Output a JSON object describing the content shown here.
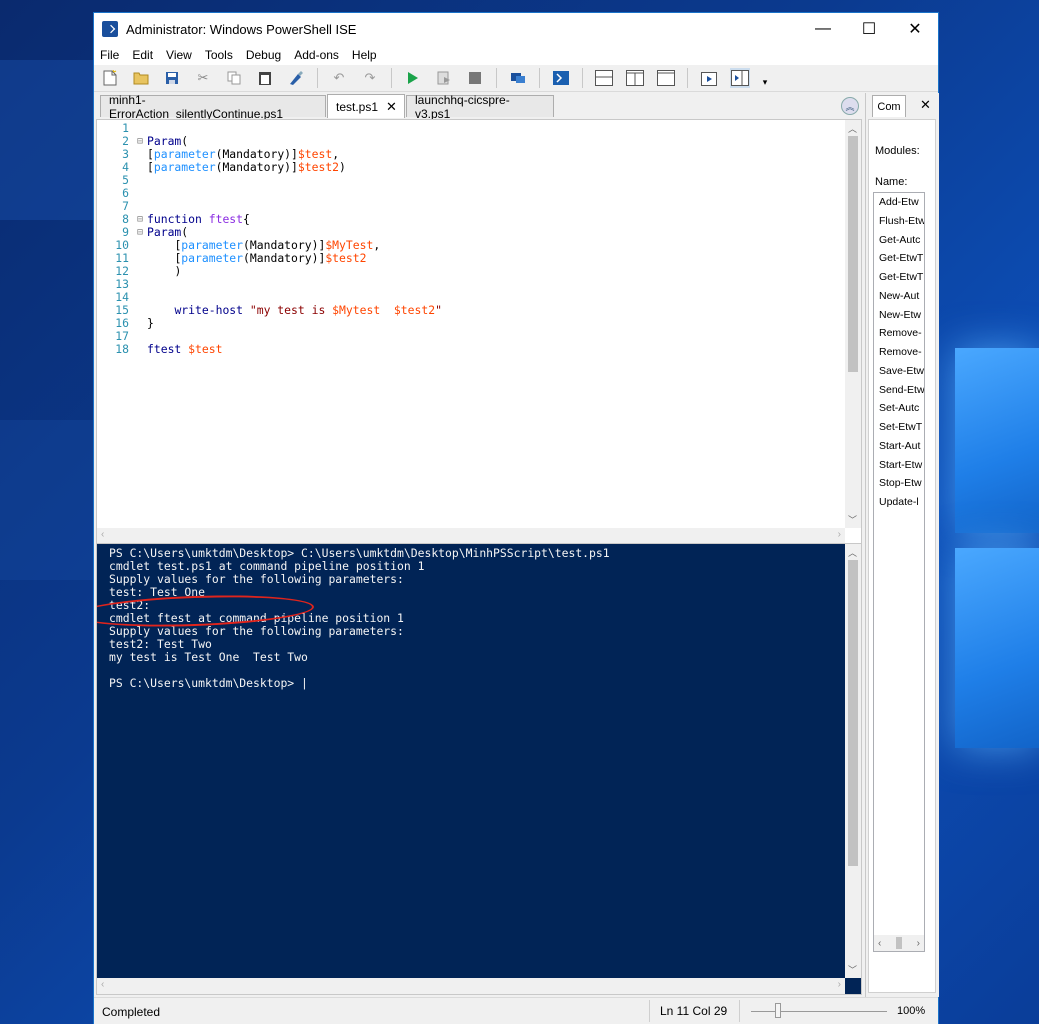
{
  "window": {
    "title": "Administrator: Windows PowerShell ISE",
    "controls": {
      "minimize": "—",
      "maximize": "☐",
      "close": "✕"
    }
  },
  "menu": [
    "File",
    "Edit",
    "View",
    "Tools",
    "Debug",
    "Add-ons",
    "Help"
  ],
  "toolbar": [
    "new-icon",
    "open-icon",
    "save-icon",
    "cut-icon",
    "copy-icon",
    "paste-icon",
    "clear-icon",
    "undo-icon",
    "redo-icon",
    "run-icon",
    "run-selection-icon",
    "stop-icon",
    "remote-icon",
    "powershell-icon",
    "layout-top-icon",
    "layout-right-icon",
    "layout-max-icon",
    "show-script-icon",
    "show-commands-icon"
  ],
  "tabs": [
    {
      "label": "minh1-ErrorAction_silentlyContinue.ps1",
      "active": false
    },
    {
      "label": "test.ps1",
      "active": true
    },
    {
      "label": "launchhq-cicspre-v3.ps1",
      "active": false
    }
  ],
  "editor": {
    "lines": [
      {
        "n": "1",
        "fold": "",
        "html": ""
      },
      {
        "n": "2",
        "fold": "⊟",
        "html": "<span class='kw'>Param</span><span class='tx'>(</span>"
      },
      {
        "n": "3",
        "fold": "",
        "html": "<span class='tx'>[</span><span class='at'>parameter</span><span class='tx'>(Mandatory)]</span><span class='vr'>$test</span><span class='tx'>,</span>"
      },
      {
        "n": "4",
        "fold": "",
        "html": "<span class='tx'>[</span><span class='at'>parameter</span><span class='tx'>(Mandatory)]</span><span class='vr'>$test2</span><span class='tx'>)</span>"
      },
      {
        "n": "5",
        "fold": "",
        "html": ""
      },
      {
        "n": "6",
        "fold": "",
        "html": ""
      },
      {
        "n": "7",
        "fold": "",
        "html": ""
      },
      {
        "n": "8",
        "fold": "⊟",
        "html": "<span class='kw'>function</span> <span class='fn'>ftest</span><span class='tx'>{</span>"
      },
      {
        "n": "9",
        "fold": "⊟",
        "html": "<span class='kw'>Param</span><span class='tx'>(</span>"
      },
      {
        "n": "10",
        "fold": "",
        "html": "    <span class='tx'>[</span><span class='at'>parameter</span><span class='tx'>(Mandatory)]</span><span class='vr'>$MyTest</span><span class='tx'>,</span>"
      },
      {
        "n": "11",
        "fold": "",
        "html": "    <span class='tx'>[</span><span class='at'>parameter</span><span class='tx'>(Mandatory)]</span><span class='vr'>$test2</span>"
      },
      {
        "n": "12",
        "fold": "",
        "html": "    <span class='tx'>)</span>"
      },
      {
        "n": "13",
        "fold": "",
        "html": ""
      },
      {
        "n": "14",
        "fold": "",
        "html": ""
      },
      {
        "n": "15",
        "fold": "",
        "html": "    <span class='cm'>write-host</span> <span class='st'>\"my test is </span><span class='vr'>$Mytest</span><span class='st'>  </span><span class='vr'>$test2</span><span class='st'>\"</span>"
      },
      {
        "n": "16",
        "fold": "",
        "html": "<span class='tx'>}</span>"
      },
      {
        "n": "17",
        "fold": "",
        "html": ""
      },
      {
        "n": "18",
        "fold": "",
        "html": "<span class='cm'>ftest</span> <span class='vr'>$test</span>"
      }
    ]
  },
  "console": {
    "text": "PS C:\\Users\\umktdm\\Desktop> C:\\Users\\umktdm\\Desktop\\MinhPSScript\\test.ps1\ncmdlet test.ps1 at command pipeline position 1\nSupply values for the following parameters:\ntest: Test One\ntest2:\ncmdlet ftest at command pipeline position 1\nSupply values for the following parameters:\ntest2: Test Two\nmy test is Test One  Test Two\n\nPS C:\\Users\\umktdm\\Desktop> |"
  },
  "commands_pane": {
    "tab_label": "Com",
    "modules_label": "Modules:",
    "name_label": "Name:",
    "items": [
      "Add-Etw",
      "Flush-Etw",
      "Get-Autc",
      "Get-EtwT",
      "Get-EtwT",
      "New-Aut",
      "New-Etw",
      "Remove-",
      "Remove-",
      "Save-Etw",
      "Send-Etw",
      "Set-Autc",
      "Set-EtwT",
      "Start-Aut",
      "Start-Etw",
      "Stop-Etw",
      "Update-l"
    ]
  },
  "status": {
    "text": "Completed",
    "position": "Ln 11  Col 29",
    "zoom": "100%"
  }
}
